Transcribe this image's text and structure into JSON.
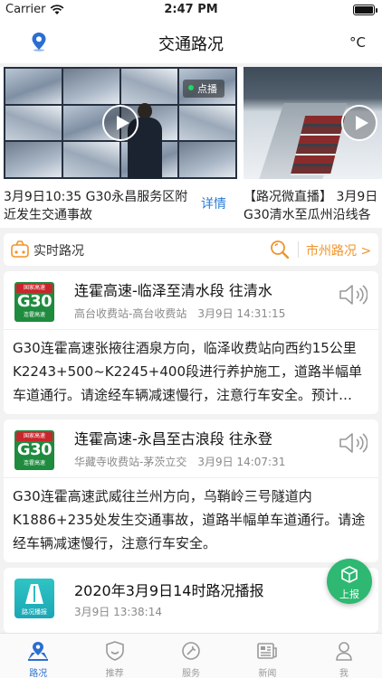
{
  "status_bar": {
    "carrier": "Carrier",
    "time": "2:47 PM"
  },
  "header": {
    "title": "交通路况",
    "temp_unit": "°C"
  },
  "carousel": {
    "slides": [
      {
        "live_tag": "点播",
        "caption": "3月9日10:35 G30永昌服务区附近发生交通事故",
        "detail": "详情"
      },
      {
        "caption_line1": "【路况微直播】 3月9日",
        "caption_line2": "G30清水至瓜州沿线各"
      }
    ]
  },
  "realtime": {
    "label": "实时路况",
    "city_link": "市州路况 >"
  },
  "cards": [
    {
      "badge": {
        "top": "国家高速",
        "number": "G30",
        "bottom": "连霍高速"
      },
      "title": "连霍高速-临泽至清水段    往清水",
      "stations": "高台收费站-高台收费站",
      "time": "3月9日  14:31:15",
      "body": "G30连霍高速张掖往酒泉方向，临泽收费站向西约15公里K2243+500~K2245+400段进行养护施工，道路半幅单车道通行。请途经车辆减速慢行，注意行车安全。预计…"
    },
    {
      "badge": {
        "top": "国家高速",
        "number": "G30",
        "bottom": "连霍高速"
      },
      "title": "连霍高速-永昌至古浪段    往永登",
      "stations": "华藏寺收费站-茅茨立交",
      "time": "3月9日  14:07:31",
      "body": "G30连霍高速武威往兰州方向，乌鞘岭三号隧道内K1886+235处发生交通事故，道路半幅单车道通行。请途经车辆减速慢行，注意行车安全。"
    },
    {
      "badge_label": "路况播报",
      "title": "2020年3月9日14时路况播报",
      "time": "3月9日  13:38:14"
    }
  ],
  "fab": {
    "label": "上报"
  },
  "tabs": [
    {
      "label": "路况",
      "icon": "road-condition-icon",
      "active": true
    },
    {
      "label": "推荐",
      "icon": "recommend-icon"
    },
    {
      "label": "服务",
      "icon": "service-icon"
    },
    {
      "label": "新闻",
      "icon": "news-icon"
    },
    {
      "label": "我",
      "icon": "profile-icon"
    }
  ],
  "colors": {
    "accent": "#2a6fd1",
    "link": "#2a7bd5",
    "orange": "#f0942a",
    "badge_green": "#1e8b3e",
    "badge_red": "#c8262c",
    "fab_green": "#2eb872"
  }
}
